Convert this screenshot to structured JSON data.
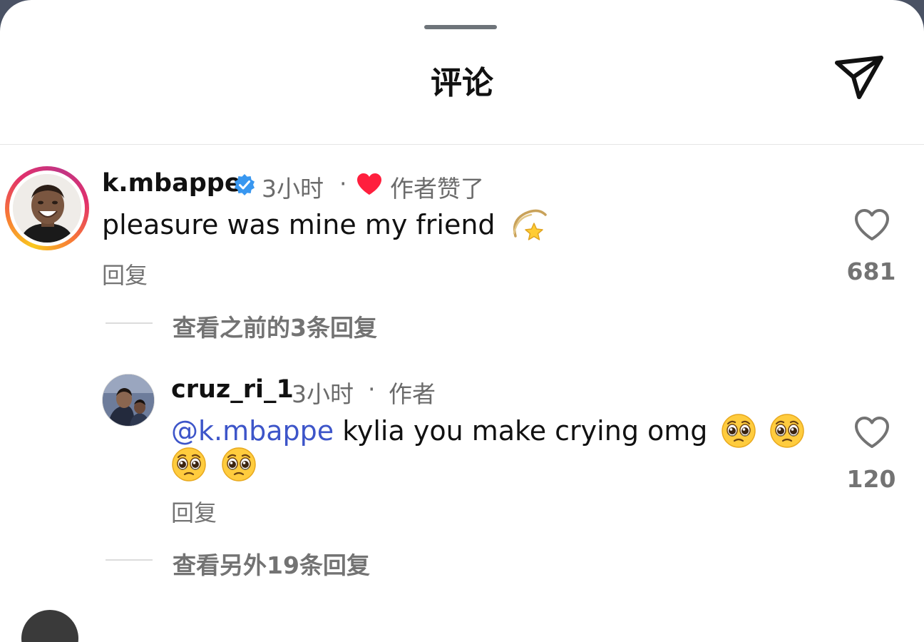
{
  "header": {
    "title": "评论"
  },
  "comments": [
    {
      "username": "k.mbappe",
      "time": "3小时",
      "separator": "·",
      "author_liked": "作者赞了",
      "text": "pleasure was mine my friend",
      "reply_label": "回复",
      "like_count": "681",
      "view_previous_replies": "查看之前的3条回复"
    },
    {
      "username": "cruz_ri_1",
      "time": "3小时",
      "separator": "·",
      "author_badge": "作者",
      "mention": "@k.mbappe",
      "text": "kylia you make crying omg",
      "reply_label": "回复",
      "like_count": "120",
      "view_more_replies": "查看另外19条回复"
    }
  ],
  "colors": {
    "mention": "#3d55c9",
    "verified": "#3897f0",
    "heart": "#ff1f3d",
    "muted": "#737373"
  },
  "icons": [
    "share-icon",
    "verified-badge-icon",
    "red-heart-icon",
    "dizzy-star-emoji",
    "pleading-face-emoji",
    "heart-outline-icon"
  ]
}
